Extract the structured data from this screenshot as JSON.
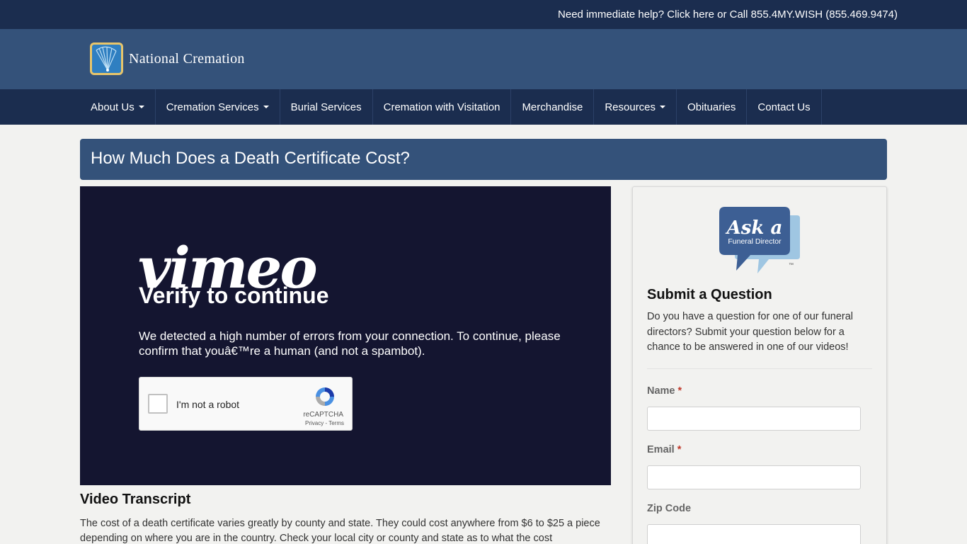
{
  "topbar": {
    "help_text": "Need immediate help? Click here or Call 855.4MY.WISH (855.469.9474)"
  },
  "brand": {
    "name": "National Cremation",
    "logo_icon": "fan-logo-icon"
  },
  "nav": {
    "items": [
      {
        "label": "About Us",
        "dropdown": true
      },
      {
        "label": "Cremation Services",
        "dropdown": true
      },
      {
        "label": "Burial Services",
        "dropdown": false
      },
      {
        "label": "Cremation with Visitation",
        "dropdown": false
      },
      {
        "label": "Merchandise",
        "dropdown": false
      },
      {
        "label": "Resources",
        "dropdown": true
      },
      {
        "label": "Obituaries",
        "dropdown": false
      },
      {
        "label": "Contact Us",
        "dropdown": false
      }
    ]
  },
  "page": {
    "title": "How Much Does a Death Certificate Cost?"
  },
  "video": {
    "brand": "vimeo",
    "heading": "Verify to continue",
    "message": "We detected a high number of errors from your connection. To continue, please confirm that youâ€™re a human (and not a spambot).",
    "captcha": {
      "label": "I'm not a robot",
      "brand": "reCAPTCHA",
      "links": "Privacy - Terms"
    }
  },
  "transcript": {
    "heading": "Video Transcript",
    "body": "The cost of a death certificate varies greatly by county and state. They could cost anywhere from $6 to $25 a piece depending on where you are in the country. Check your local city or county and state as to what the cost"
  },
  "sidebar": {
    "logo": {
      "line1": "Ask a",
      "line2": "Funeral Director",
      "tm": "™"
    },
    "title": "Submit a Question",
    "description": "Do you have a question for one of our funeral directors? Submit your question below for a chance to be answered in one of our videos!",
    "fields": [
      {
        "label": "Name",
        "required": "*"
      },
      {
        "label": "Email",
        "required": "*"
      },
      {
        "label": "Zip Code",
        "required": ""
      }
    ]
  },
  "colors": {
    "top": "#1b2d4f",
    "brand_bar": "#34527a",
    "video_bg": "#141530",
    "logo_border": "#e8c56a"
  }
}
